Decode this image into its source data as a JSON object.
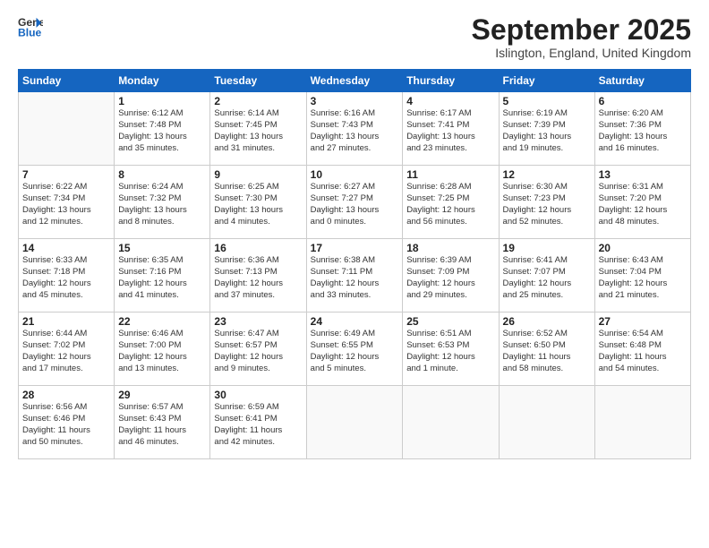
{
  "header": {
    "logo_line1": "General",
    "logo_line2": "Blue",
    "month_title": "September 2025",
    "subtitle": "Islington, England, United Kingdom"
  },
  "days_of_week": [
    "Sunday",
    "Monday",
    "Tuesday",
    "Wednesday",
    "Thursday",
    "Friday",
    "Saturday"
  ],
  "weeks": [
    [
      {
        "day": "",
        "info": ""
      },
      {
        "day": "1",
        "info": "Sunrise: 6:12 AM\nSunset: 7:48 PM\nDaylight: 13 hours\nand 35 minutes."
      },
      {
        "day": "2",
        "info": "Sunrise: 6:14 AM\nSunset: 7:45 PM\nDaylight: 13 hours\nand 31 minutes."
      },
      {
        "day": "3",
        "info": "Sunrise: 6:16 AM\nSunset: 7:43 PM\nDaylight: 13 hours\nand 27 minutes."
      },
      {
        "day": "4",
        "info": "Sunrise: 6:17 AM\nSunset: 7:41 PM\nDaylight: 13 hours\nand 23 minutes."
      },
      {
        "day": "5",
        "info": "Sunrise: 6:19 AM\nSunset: 7:39 PM\nDaylight: 13 hours\nand 19 minutes."
      },
      {
        "day": "6",
        "info": "Sunrise: 6:20 AM\nSunset: 7:36 PM\nDaylight: 13 hours\nand 16 minutes."
      }
    ],
    [
      {
        "day": "7",
        "info": "Sunrise: 6:22 AM\nSunset: 7:34 PM\nDaylight: 13 hours\nand 12 minutes."
      },
      {
        "day": "8",
        "info": "Sunrise: 6:24 AM\nSunset: 7:32 PM\nDaylight: 13 hours\nand 8 minutes."
      },
      {
        "day": "9",
        "info": "Sunrise: 6:25 AM\nSunset: 7:30 PM\nDaylight: 13 hours\nand 4 minutes."
      },
      {
        "day": "10",
        "info": "Sunrise: 6:27 AM\nSunset: 7:27 PM\nDaylight: 13 hours\nand 0 minutes."
      },
      {
        "day": "11",
        "info": "Sunrise: 6:28 AM\nSunset: 7:25 PM\nDaylight: 12 hours\nand 56 minutes."
      },
      {
        "day": "12",
        "info": "Sunrise: 6:30 AM\nSunset: 7:23 PM\nDaylight: 12 hours\nand 52 minutes."
      },
      {
        "day": "13",
        "info": "Sunrise: 6:31 AM\nSunset: 7:20 PM\nDaylight: 12 hours\nand 48 minutes."
      }
    ],
    [
      {
        "day": "14",
        "info": "Sunrise: 6:33 AM\nSunset: 7:18 PM\nDaylight: 12 hours\nand 45 minutes."
      },
      {
        "day": "15",
        "info": "Sunrise: 6:35 AM\nSunset: 7:16 PM\nDaylight: 12 hours\nand 41 minutes."
      },
      {
        "day": "16",
        "info": "Sunrise: 6:36 AM\nSunset: 7:13 PM\nDaylight: 12 hours\nand 37 minutes."
      },
      {
        "day": "17",
        "info": "Sunrise: 6:38 AM\nSunset: 7:11 PM\nDaylight: 12 hours\nand 33 minutes."
      },
      {
        "day": "18",
        "info": "Sunrise: 6:39 AM\nSunset: 7:09 PM\nDaylight: 12 hours\nand 29 minutes."
      },
      {
        "day": "19",
        "info": "Sunrise: 6:41 AM\nSunset: 7:07 PM\nDaylight: 12 hours\nand 25 minutes."
      },
      {
        "day": "20",
        "info": "Sunrise: 6:43 AM\nSunset: 7:04 PM\nDaylight: 12 hours\nand 21 minutes."
      }
    ],
    [
      {
        "day": "21",
        "info": "Sunrise: 6:44 AM\nSunset: 7:02 PM\nDaylight: 12 hours\nand 17 minutes."
      },
      {
        "day": "22",
        "info": "Sunrise: 6:46 AM\nSunset: 7:00 PM\nDaylight: 12 hours\nand 13 minutes."
      },
      {
        "day": "23",
        "info": "Sunrise: 6:47 AM\nSunset: 6:57 PM\nDaylight: 12 hours\nand 9 minutes."
      },
      {
        "day": "24",
        "info": "Sunrise: 6:49 AM\nSunset: 6:55 PM\nDaylight: 12 hours\nand 5 minutes."
      },
      {
        "day": "25",
        "info": "Sunrise: 6:51 AM\nSunset: 6:53 PM\nDaylight: 12 hours\nand 1 minute."
      },
      {
        "day": "26",
        "info": "Sunrise: 6:52 AM\nSunset: 6:50 PM\nDaylight: 11 hours\nand 58 minutes."
      },
      {
        "day": "27",
        "info": "Sunrise: 6:54 AM\nSunset: 6:48 PM\nDaylight: 11 hours\nand 54 minutes."
      }
    ],
    [
      {
        "day": "28",
        "info": "Sunrise: 6:56 AM\nSunset: 6:46 PM\nDaylight: 11 hours\nand 50 minutes."
      },
      {
        "day": "29",
        "info": "Sunrise: 6:57 AM\nSunset: 6:43 PM\nDaylight: 11 hours\nand 46 minutes."
      },
      {
        "day": "30",
        "info": "Sunrise: 6:59 AM\nSunset: 6:41 PM\nDaylight: 11 hours\nand 42 minutes."
      },
      {
        "day": "",
        "info": ""
      },
      {
        "day": "",
        "info": ""
      },
      {
        "day": "",
        "info": ""
      },
      {
        "day": "",
        "info": ""
      }
    ]
  ]
}
